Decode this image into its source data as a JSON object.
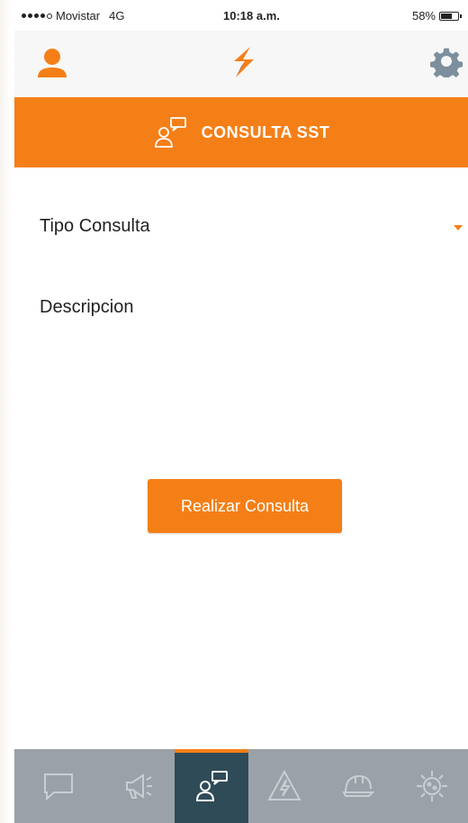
{
  "status_bar": {
    "carrier": "Movistar",
    "network": "4G",
    "time": "10:18 a.m.",
    "battery": "58%",
    "battery_level": 0.58
  },
  "header": {
    "user_icon": "user-icon",
    "logo_icon": "lightning-logo-icon",
    "settings_icon": "gear-icon"
  },
  "banner": {
    "icon": "consult-chat-icon",
    "title": "CONSULTA SST"
  },
  "form": {
    "tipo_label": "Tipo Consulta",
    "descripcion_label": "Descripcion"
  },
  "submit_label": "Realizar Consulta",
  "bottom_nav": {
    "items": [
      {
        "icon": "chat-bubble-icon",
        "active": false
      },
      {
        "icon": "megaphone-icon",
        "active": false
      },
      {
        "icon": "consult-chat-icon",
        "active": true
      },
      {
        "icon": "electric-hazard-icon",
        "active": false
      },
      {
        "icon": "hard-hat-icon",
        "active": false
      },
      {
        "icon": "virus-gear-icon",
        "active": false
      }
    ]
  },
  "colors": {
    "accent": "#f57f17",
    "nav_bg": "#9aa1a8",
    "nav_active": "#2f4b57",
    "header_bg": "#f7f7f7"
  }
}
